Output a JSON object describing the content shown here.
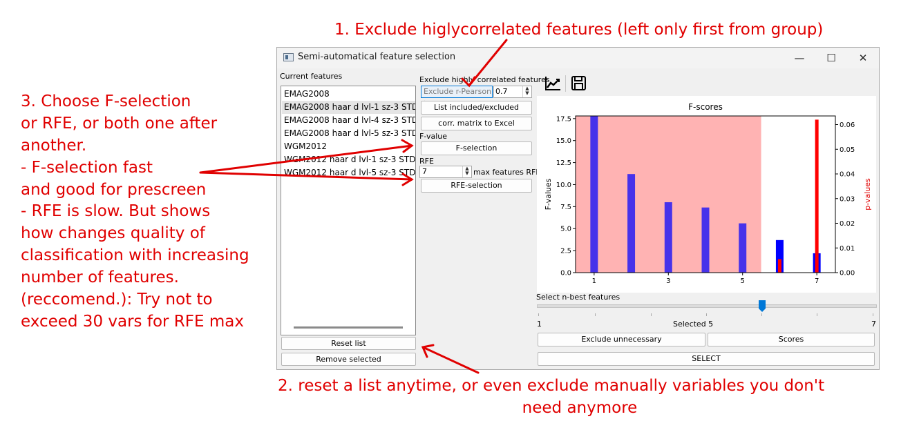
{
  "annotations": {
    "top": "1. Exclude higlycorrelated features (left only first from group)",
    "left": [
      "3. Choose F-selection",
      "or RFE, or both one after",
      "another.",
      "- F-selection fast",
      "and good for prescreen",
      "- RFE is slow. But shows",
      "how changes quality of",
      "classification with increasing",
      "number of features.",
      "(reccomend.): Try not to",
      "exceed 30 vars for RFE max"
    ],
    "bottom_line1": "2. reset a list anytime, or even exclude manually variables you don't",
    "bottom_line2": "need anymore",
    "color": "#e00000"
  },
  "window": {
    "title": "Semi-automatical feature selection",
    "minimize": "—",
    "maximize": "☐",
    "close": "✕"
  },
  "left_panel": {
    "label": "Current features",
    "items": [
      "EMAG2008",
      "EMAG2008 haar d lvl-1 sz-3 STD",
      "EMAG2008 haar d lvl-4 sz-3 STD",
      "EMAG2008 haar d lvl-5 sz-3 STD",
      "WGM2012",
      "WGM2012 haar d lvl-1 sz-3 STD",
      "WGM2012 haar d lvl-5 sz-3 STD"
    ],
    "reset_button": "Reset list",
    "remove_button": "Remove selected"
  },
  "middle_panel": {
    "exclude_label": "Exclude highly correlated features",
    "exclude_select": "Exclude r-Pearson >",
    "threshold": "0.7",
    "list_button": "List included/excluded",
    "corr_button": "corr. matrix to Excel",
    "fvalue_label": "F-value",
    "fselect_button": "F-selection",
    "rfe_label": "RFE",
    "rfe_max": "7",
    "rfe_max_label": "max features RFE",
    "rfe_button": "RFE-selection"
  },
  "toolbar": {
    "chart_icon": "line-chart-icon",
    "save_icon": "floppy-disk-icon"
  },
  "chart_data": {
    "type": "bar",
    "title": "F-scores",
    "ylabel": "F-values",
    "y2label": "p-values",
    "x": [
      1,
      2,
      3,
      4,
      5,
      6,
      7
    ],
    "x_ticks": [
      "1",
      "3",
      "5",
      "7"
    ],
    "ylim": [
      0,
      17.8
    ],
    "y_ticks": [
      "0.0",
      "2.5",
      "5.0",
      "7.5",
      "10.0",
      "12.5",
      "15.0",
      "17.5"
    ],
    "y2lim": [
      0,
      0.0635
    ],
    "y2_ticks": [
      "0.00",
      "0.01",
      "0.02",
      "0.03",
      "0.04",
      "0.05",
      "0.06"
    ],
    "series": [
      {
        "values": [
          17.8,
          11.2,
          8.0,
          7.4,
          5.6,
          3.7,
          2.2
        ],
        "color": "#0000ff",
        "axis": "left"
      },
      {
        "values": [
          0.0,
          0.0,
          0.0,
          0.0,
          0.0,
          0.0055,
          0.062
        ],
        "color": "#ff0000",
        "axis": "right"
      }
    ],
    "selected_region": {
      "from": 0.5,
      "to": 5.5,
      "color": "#ffb3b3"
    }
  },
  "slider": {
    "label": "Select n-best features",
    "min": "1",
    "max": "7",
    "selected_text": "Selected 5",
    "value": 5
  },
  "bottom_buttons": {
    "exclude": "Exclude unnecessary",
    "scores": "Scores",
    "select": "SELECT"
  }
}
